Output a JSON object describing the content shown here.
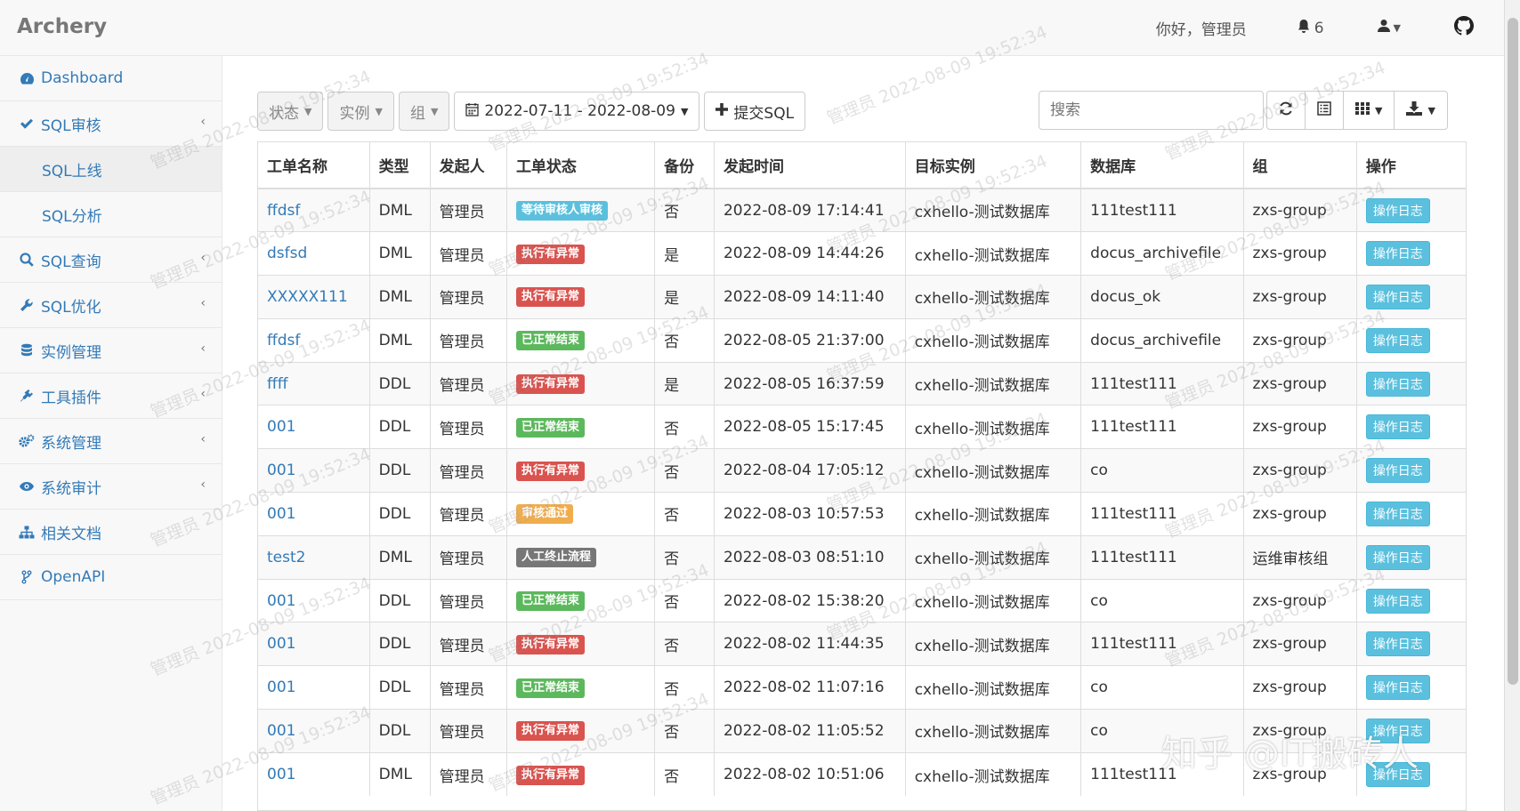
{
  "app": {
    "brand": "Archery"
  },
  "navbar": {
    "greeting": "你好，管理员",
    "notif_count": "6"
  },
  "sidebar": {
    "items": [
      {
        "label": "Dashboard",
        "icon": "dashboard-icon"
      },
      {
        "label": "SQL审核",
        "icon": "check-icon"
      },
      {
        "label": "SQL上线",
        "sub": true,
        "active": true
      },
      {
        "label": "SQL分析",
        "sub": true
      },
      {
        "label": "SQL查询",
        "icon": "search-icon"
      },
      {
        "label": "SQL优化",
        "icon": "wrench-icon"
      },
      {
        "label": "实例管理",
        "icon": "database-icon"
      },
      {
        "label": "工具插件",
        "icon": "plug-icon"
      },
      {
        "label": "系统管理",
        "icon": "cogs-icon"
      },
      {
        "label": "系统审计",
        "icon": "eye-icon"
      },
      {
        "label": "相关文档",
        "icon": "sitemap-icon"
      },
      {
        "label": "OpenAPI",
        "icon": "code-fork-icon"
      }
    ]
  },
  "toolbar": {
    "status_filter": "状态",
    "instance_filter": "实例",
    "group_filter": "组",
    "date_range": "2022-07-11 - 2022-08-09",
    "submit_label": "提交SQL",
    "search_placeholder": "搜索"
  },
  "table": {
    "columns": [
      "工单名称",
      "类型",
      "发起人",
      "工单状态",
      "备份",
      "发起时间",
      "目标实例",
      "数据库",
      "组",
      "操作"
    ],
    "action_label": "操作日志",
    "rows": [
      {
        "name": "ffdsf",
        "type": "DML",
        "user": "管理员",
        "status": "等待审核人审核",
        "status_kind": "info",
        "backup": "否",
        "time": "2022-08-09 17:14:41",
        "instance": "cxhello-测试数据库",
        "db": "111test111",
        "group": "zxs-group"
      },
      {
        "name": "dsfsd",
        "type": "DML",
        "user": "管理员",
        "status": "执行有异常",
        "status_kind": "danger",
        "backup": "是",
        "time": "2022-08-09 14:44:26",
        "instance": "cxhello-测试数据库",
        "db": "docus_archivefile",
        "group": "zxs-group"
      },
      {
        "name": "XXXXX111",
        "type": "DML",
        "user": "管理员",
        "status": "执行有异常",
        "status_kind": "danger",
        "backup": "是",
        "time": "2022-08-09 14:11:40",
        "instance": "cxhello-测试数据库",
        "db": "docus_ok",
        "group": "zxs-group"
      },
      {
        "name": "ffdsf",
        "type": "DML",
        "user": "管理员",
        "status": "已正常结束",
        "status_kind": "success",
        "backup": "否",
        "time": "2022-08-05 21:37:00",
        "instance": "cxhello-测试数据库",
        "db": "docus_archivefile",
        "group": "zxs-group"
      },
      {
        "name": "ffff",
        "type": "DDL",
        "user": "管理员",
        "status": "执行有异常",
        "status_kind": "danger",
        "backup": "是",
        "time": "2022-08-05 16:37:59",
        "instance": "cxhello-测试数据库",
        "db": "111test111",
        "group": "zxs-group"
      },
      {
        "name": "001",
        "type": "DDL",
        "user": "管理员",
        "status": "已正常结束",
        "status_kind": "success",
        "backup": "否",
        "time": "2022-08-05 15:17:45",
        "instance": "cxhello-测试数据库",
        "db": "111test111",
        "group": "zxs-group"
      },
      {
        "name": "001",
        "type": "DDL",
        "user": "管理员",
        "status": "执行有异常",
        "status_kind": "danger",
        "backup": "否",
        "time": "2022-08-04 17:05:12",
        "instance": "cxhello-测试数据库",
        "db": "co",
        "group": "zxs-group"
      },
      {
        "name": "001",
        "type": "DDL",
        "user": "管理员",
        "status": "审核通过",
        "status_kind": "warning",
        "backup": "否",
        "time": "2022-08-03 10:57:53",
        "instance": "cxhello-测试数据库",
        "db": "111test111",
        "group": "zxs-group"
      },
      {
        "name": "test2",
        "type": "DML",
        "user": "管理员",
        "status": "人工终止流程",
        "status_kind": "default",
        "backup": "否",
        "time": "2022-08-03 08:51:10",
        "instance": "cxhello-测试数据库",
        "db": "111test111",
        "group": "运维审核组"
      },
      {
        "name": "001",
        "type": "DDL",
        "user": "管理员",
        "status": "已正常结束",
        "status_kind": "success",
        "backup": "否",
        "time": "2022-08-02 15:38:20",
        "instance": "cxhello-测试数据库",
        "db": "co",
        "group": "zxs-group"
      },
      {
        "name": "001",
        "type": "DDL",
        "user": "管理员",
        "status": "执行有异常",
        "status_kind": "danger",
        "backup": "否",
        "time": "2022-08-02 11:44:35",
        "instance": "cxhello-测试数据库",
        "db": "111test111",
        "group": "zxs-group"
      },
      {
        "name": "001",
        "type": "DDL",
        "user": "管理员",
        "status": "已正常结束",
        "status_kind": "success",
        "backup": "否",
        "time": "2022-08-02 11:07:16",
        "instance": "cxhello-测试数据库",
        "db": "co",
        "group": "zxs-group"
      },
      {
        "name": "001",
        "type": "DDL",
        "user": "管理员",
        "status": "执行有异常",
        "status_kind": "danger",
        "backup": "否",
        "time": "2022-08-02 11:05:52",
        "instance": "cxhello-测试数据库",
        "db": "co",
        "group": "zxs-group"
      },
      {
        "name": "001",
        "type": "DML",
        "user": "管理员",
        "status": "执行有异常",
        "status_kind": "danger",
        "backup": "否",
        "time": "2022-08-02 10:51:06",
        "instance": "cxhello-测试数据库",
        "db": "111test111",
        "group": "zxs-group"
      }
    ]
  },
  "watermark": {
    "text": "管理员 2022-08-09 19:52:34"
  },
  "overlay": {
    "zhihu_text": "知乎 @IT搬砖人"
  },
  "colors": {
    "link": "#337ab7",
    "info": "#5bc0de",
    "danger": "#d9534f",
    "success": "#5cb85c",
    "warning": "#f0ad4e",
    "default": "#777777"
  }
}
